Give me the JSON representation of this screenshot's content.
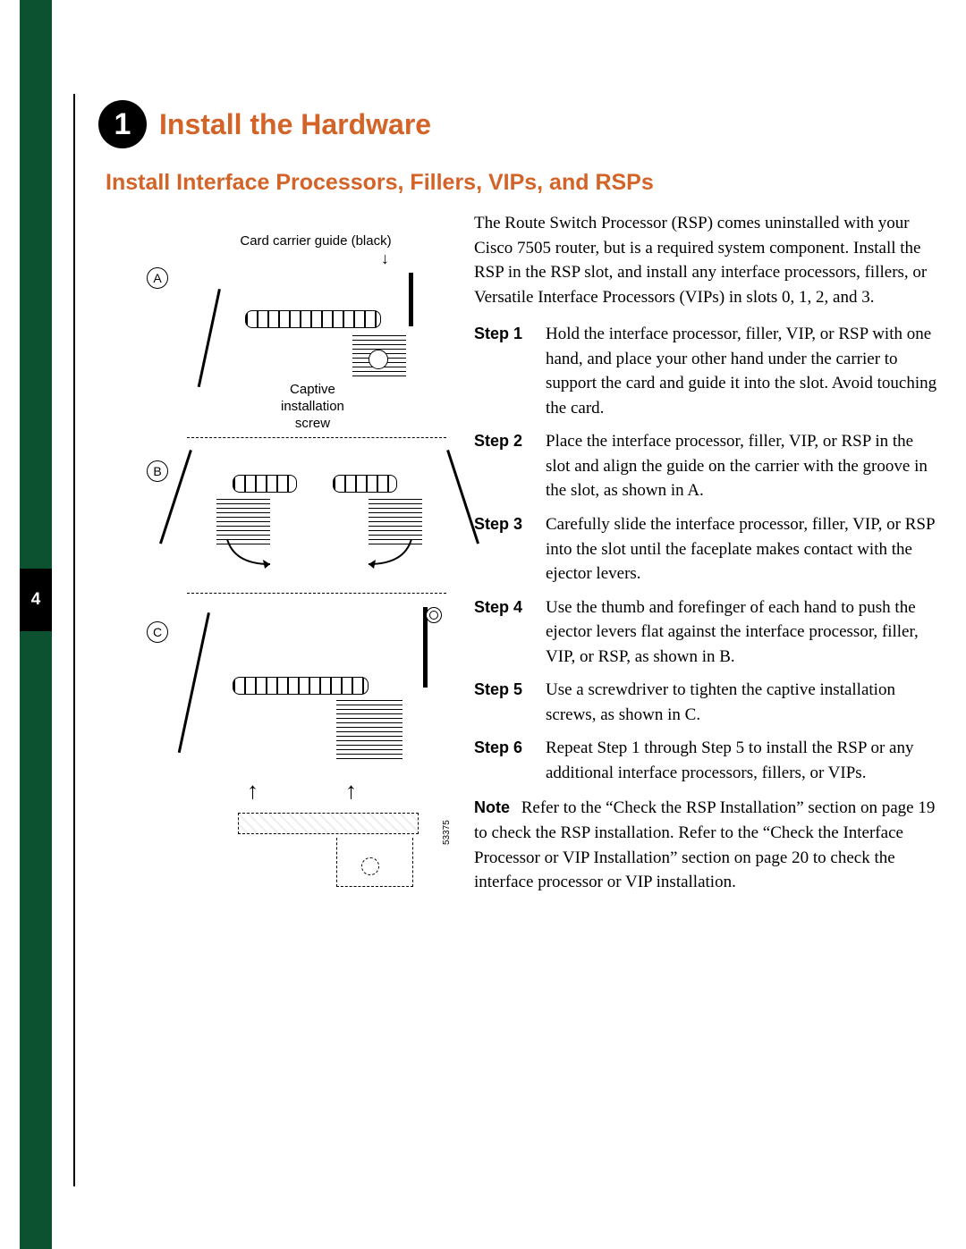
{
  "page_tab": "4",
  "heading": {
    "number": "1",
    "title": "Install the Hardware"
  },
  "subheading": "Install Interface Processors, Fillers, VIPs, and RSPs",
  "diagram": {
    "top_label": "Card carrier guide (black)",
    "label_a": "A",
    "label_b": "B",
    "label_c": "C",
    "caption_a_line1": "Captive",
    "caption_a_line2": "installation",
    "caption_a_line3": "screw",
    "figure_id": "53375"
  },
  "intro": "The Route Switch Processor (RSP) comes uninstalled with your Cisco 7505 router, but is a required system component. Install the RSP in the RSP slot, and install any interface processors, fillers, or Versatile Interface Processors (VIPs) in slots 0, 1, 2, and 3.",
  "steps": [
    {
      "label": "Step 1",
      "text": "Hold the interface processor, filler, VIP, or RSP with one hand, and place your other hand under the carrier to support the card and guide it into the slot. Avoid touching the card."
    },
    {
      "label": "Step 2",
      "text": "Place the interface processor, filler, VIP, or RSP in the slot and align the guide on the carrier with the groove in the slot, as shown in A."
    },
    {
      "label": "Step 3",
      "text": "Carefully slide the interface processor, filler, VIP, or RSP into the slot until the faceplate makes contact with the ejector levers."
    },
    {
      "label": "Step 4",
      "text": "Use the thumb and forefinger of each hand to push the ejector levers flat against the interface processor, filler, VIP, or RSP, as shown in B."
    },
    {
      "label": "Step 5",
      "text": "Use a screwdriver to tighten the captive installation screws, as shown in C."
    },
    {
      "label": "Step 6",
      "text": "Repeat Step 1 through Step 5 to install the RSP or any additional interface processors, fillers, or VIPs."
    }
  ],
  "note": {
    "label": "Note",
    "text": "Refer to the “Check the RSP Installation” section on page 19 to check the RSP installation. Refer to the “Check the Interface Processor or VIP Installation” section on page 20 to check the interface processor or VIP installation."
  }
}
